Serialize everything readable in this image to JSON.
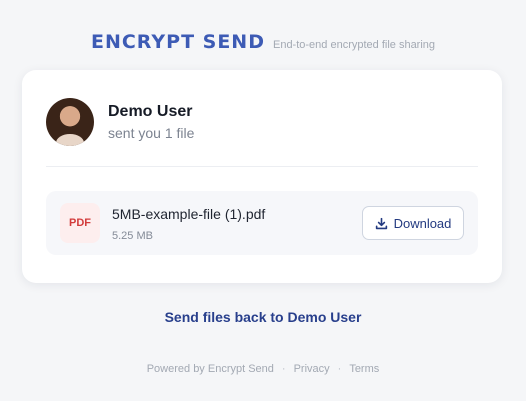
{
  "header": {
    "logo_text": "ENCRYPT SEND",
    "tagline": "End-to-end encrypted file sharing"
  },
  "sender": {
    "name": "Demo User",
    "message": "sent you 1 file"
  },
  "file": {
    "type_label": "PDF",
    "name": "5MB-example-file (1).pdf",
    "size": "5.25 MB",
    "download_label": "Download"
  },
  "send_back_label": "Send files back to Demo User",
  "footer": {
    "powered_by": "Powered by Encrypt Send",
    "separator": "·",
    "privacy": "Privacy",
    "terms": "Terms"
  },
  "colors": {
    "brand": "#3d5bb5",
    "link": "#283f8c",
    "pdf_red": "#d23b3b",
    "page_bg": "#f5f6f8"
  },
  "icons": {
    "avatar": "user-photo",
    "download": "download-icon"
  }
}
